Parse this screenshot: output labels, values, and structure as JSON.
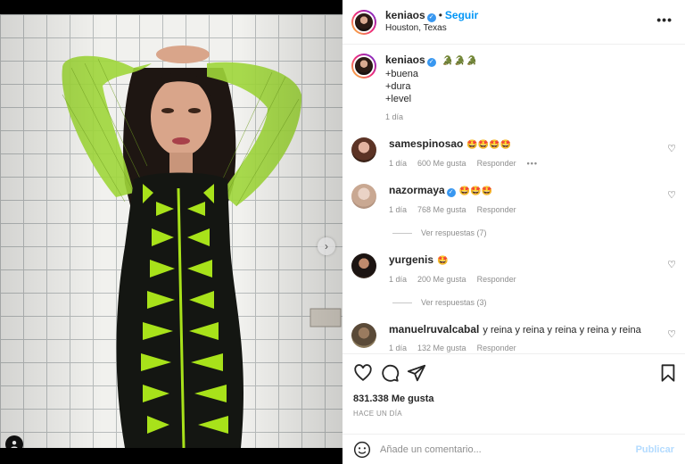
{
  "post": {
    "author": "keniaos",
    "follow_label": "Seguir",
    "separator": "•",
    "location": "Houston, Texas",
    "more_label": "•••"
  },
  "caption": {
    "username": "keniaos",
    "emojis": "🐊🐊🐊",
    "lines": [
      "+buena",
      "+dura",
      "+level"
    ],
    "time": "1 día"
  },
  "comments": [
    {
      "username": "samespinosao",
      "text": "🤩🤩🤩🤩",
      "time": "1 día",
      "likes": "600 Me gusta",
      "reply": "Responder",
      "options": "•••",
      "verified": false
    },
    {
      "username": "nazormaya",
      "text": "🤩🤩🤩",
      "time": "1 día",
      "likes": "768 Me gusta",
      "reply": "Responder",
      "verified": true,
      "view_replies": "Ver respuestas (7)"
    },
    {
      "username": "yurgenis",
      "text": "🤩",
      "time": "1 día",
      "likes": "200 Me gusta",
      "reply": "Responder",
      "verified": false,
      "view_replies": "Ver respuestas (3)"
    },
    {
      "username": "manuelruvalcabal",
      "text": "y reina y reina y reina y reina y reina",
      "time": "1 día",
      "likes": "132 Me gusta",
      "reply": "Responder",
      "verified": false
    }
  ],
  "actions": {
    "likes": "831.338 Me gusta",
    "posted": "HACE UN DÍA"
  },
  "composer": {
    "placeholder": "Añade un comentario...",
    "publish_label": "Publicar"
  },
  "carousel": {
    "slide_count": 9,
    "active_index": 0
  },
  "colors": {
    "accent": "#0095f6",
    "verified": "#3897f0",
    "outfit_green": "#a8e21a"
  }
}
